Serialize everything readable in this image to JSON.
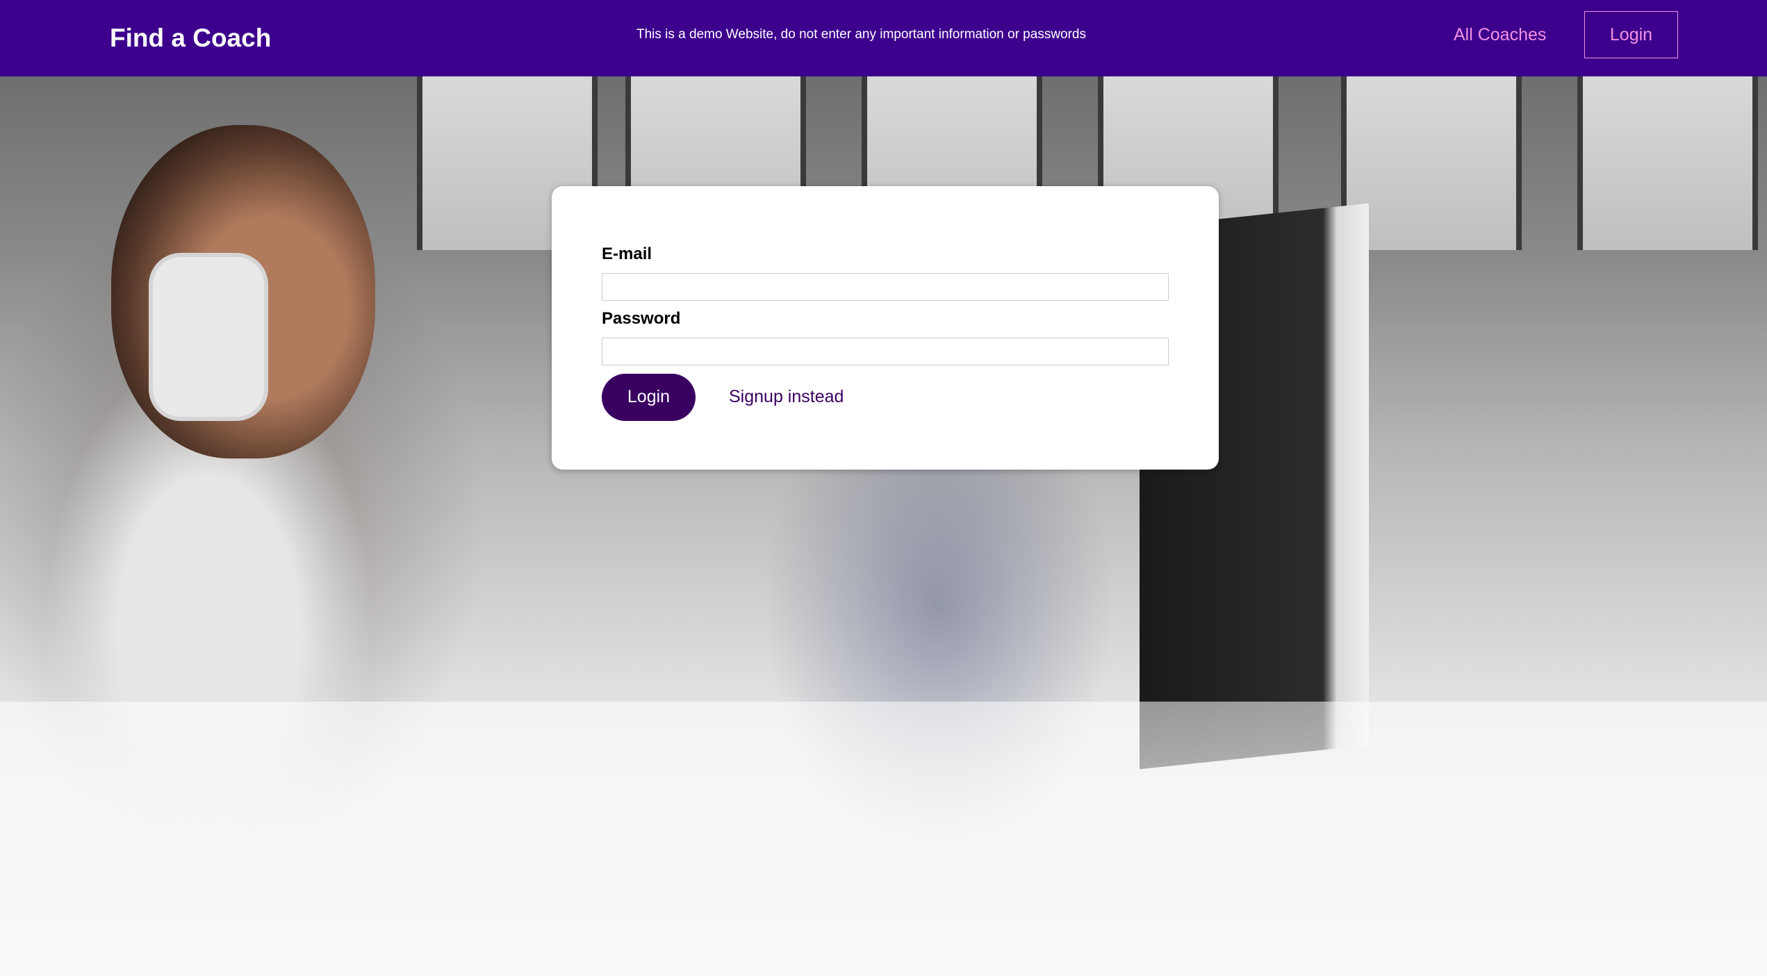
{
  "header": {
    "brand": "Find a Coach",
    "notice": "This is a demo Website, do not enter any important information or passwords",
    "nav": {
      "all_coaches": "All Coaches",
      "login": "Login"
    }
  },
  "login_form": {
    "email_label": "E-mail",
    "email_value": "",
    "password_label": "Password",
    "password_value": "",
    "submit_label": "Login",
    "switch_label": "Signup instead"
  },
  "colors": {
    "header_bg": "#3d008d",
    "nav_accent": "#f391e3",
    "button_bg": "#3a0061",
    "card_bg": "#ffffff"
  },
  "hero_image": "office-workers-photo"
}
